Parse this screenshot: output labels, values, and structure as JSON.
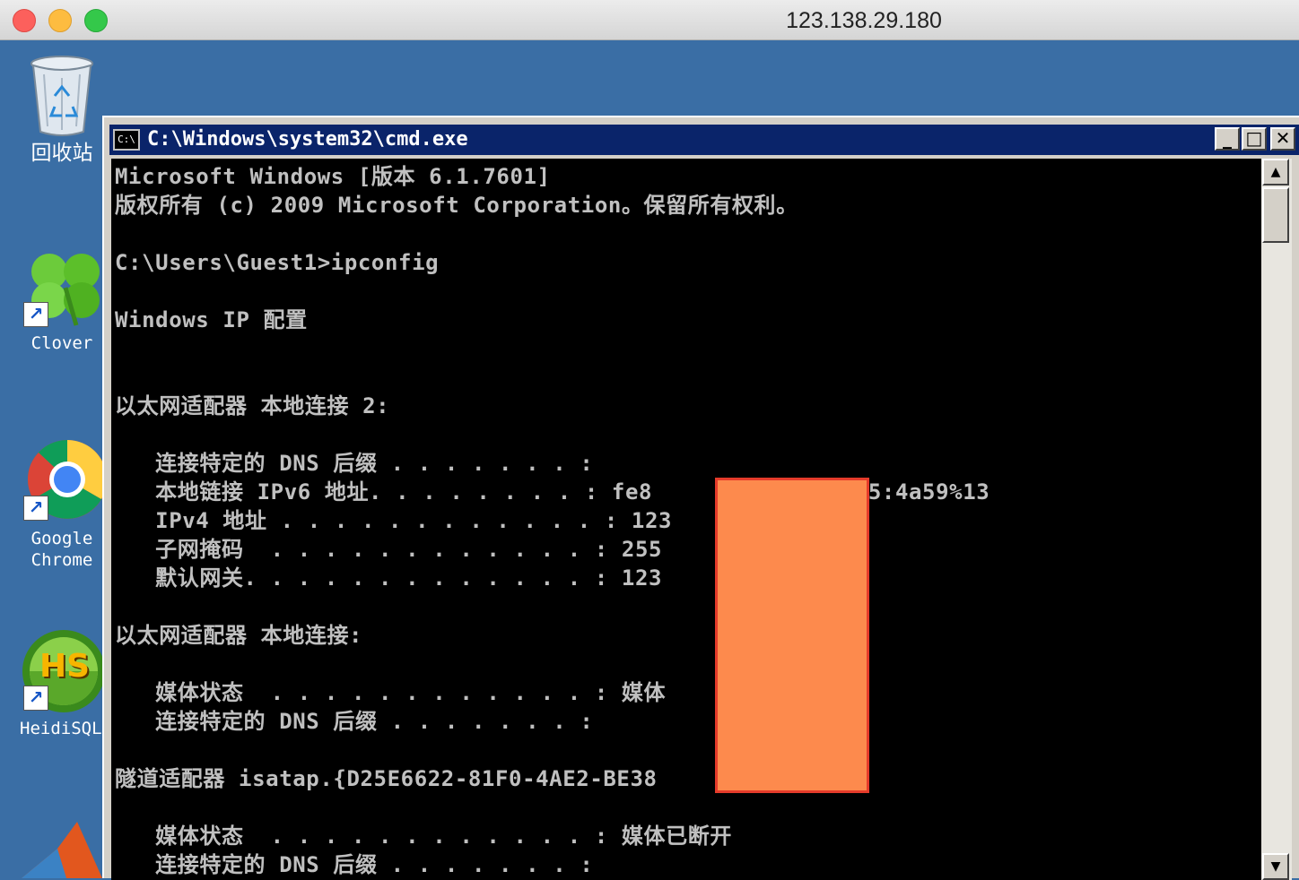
{
  "viewer": {
    "title": "123.138.29.180"
  },
  "desktop": {
    "icons": [
      {
        "name": "recycle-bin",
        "label": "回收站"
      },
      {
        "name": "clover",
        "label": "Clover"
      },
      {
        "name": "google-chrome",
        "label_line1": "Google",
        "label_line2": "Chrome"
      },
      {
        "name": "heidisql",
        "label": "HeidiSQL",
        "badge": "HS"
      }
    ]
  },
  "cmd": {
    "title": "C:\\Windows\\system32\\cmd.exe",
    "icon_text": "C:\\",
    "buttons": {
      "minimize": "_",
      "maximize": "□",
      "close": "✕"
    },
    "lines": [
      "Microsoft Windows [版本 6.1.7601]",
      "版权所有 (c) 2009 Microsoft Corporation。保留所有权利。",
      "",
      "C:\\Users\\Guest1>ipconfig",
      "",
      "Windows IP 配置",
      "",
      "",
      "以太网适配器 本地连接 2:",
      "",
      "   连接特定的 DNS 后缀 . . . . . . . :",
      "   本地链接 IPv6 地址. . . . . . . . : fe8           2:8bb5:4a59%13",
      "   IPv4 地址 . . . . . . . . . . . . : 123",
      "   子网掩码  . . . . . . . . . . . . : 255",
      "   默认网关. . . . . . . . . . . . . : 123",
      "",
      "以太网适配器 本地连接:",
      "",
      "   媒体状态  . . . . . . . . . . . . : 媒体",
      "   连接特定的 DNS 后缀 . . . . . . . :",
      "",
      "隧道适配器 isatap.{D25E6622-81F0-4AE2-BE38           91}:",
      "",
      "   媒体状态  . . . . . . . . . . . . : 媒体已断开",
      "   连接特定的 DNS 后缀 . . . . . . . :"
    ]
  },
  "colors": {
    "desktop": "#3a6ea5",
    "redaction_fill": "#fd8a4d",
    "redaction_border": "#e53b2a"
  }
}
